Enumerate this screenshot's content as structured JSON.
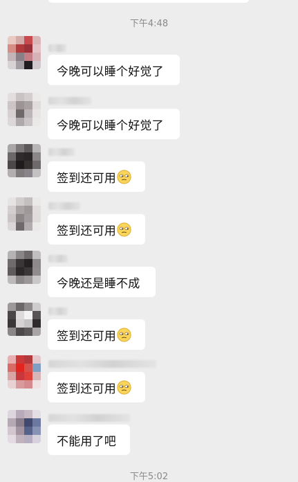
{
  "timestamps": {
    "first": "下午4:48",
    "last": "下午5:02"
  },
  "messages": [
    {
      "text": "今晚可以睡个好觉了",
      "emoji": null
    },
    {
      "text": "今晚可以睡个好觉了",
      "emoji": null
    },
    {
      "text": "签到还可用",
      "emoji": "unamused-face-icon"
    },
    {
      "text": "签到还可用",
      "emoji": "unamused-face-icon"
    },
    {
      "text": "今晚还是睡不成",
      "emoji": null
    },
    {
      "text": "签到还可用",
      "emoji": "unamused-face-icon"
    },
    {
      "text": "签到还可用",
      "emoji": "unamused-face-icon"
    },
    {
      "text": "不能用了吧",
      "emoji": null
    }
  ],
  "colors": {
    "background": "#ededed",
    "bubble": "#ffffff",
    "timestamp_text": "#8a8a8a",
    "message_text": "#111111"
  }
}
